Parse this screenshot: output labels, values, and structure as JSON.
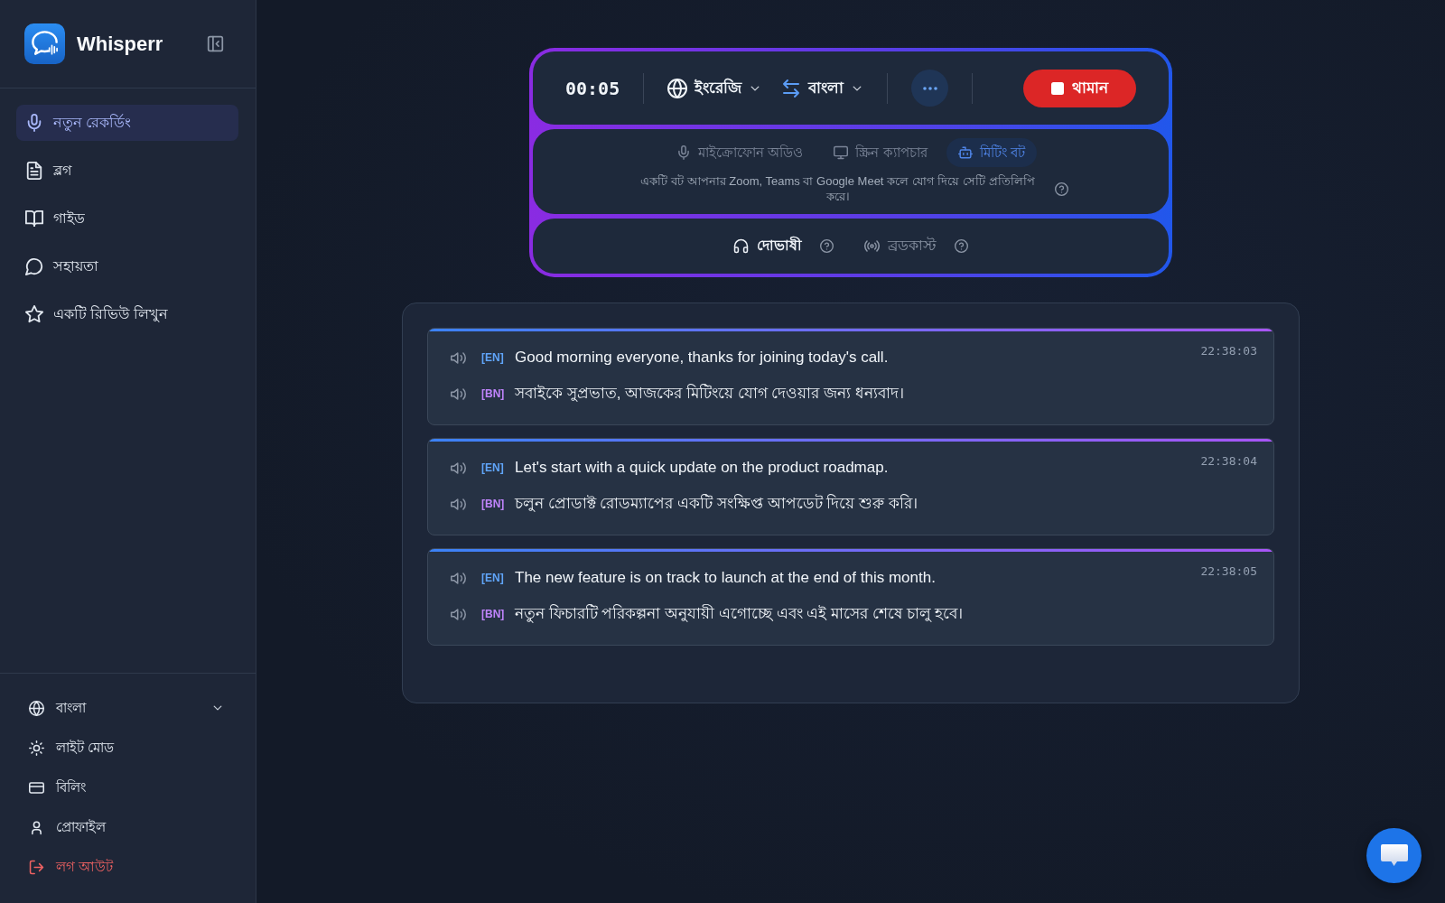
{
  "sidebar": {
    "app_name": "Whisperr",
    "nav": [
      {
        "label": "নতুন রেকর্ডিং",
        "selected": true
      },
      {
        "label": "ব্লগ",
        "selected": false
      },
      {
        "label": "গাইড",
        "selected": false
      },
      {
        "label": "সহায়তা",
        "selected": false
      },
      {
        "label": "একটি রিভিউ লিখুন",
        "selected": false
      }
    ],
    "footer": [
      {
        "label": "বাংলা",
        "kind": "select"
      },
      {
        "label": "লাইট মোড",
        "kind": "item"
      },
      {
        "label": "বিলিং",
        "kind": "item"
      },
      {
        "label": "প্রোফাইল",
        "kind": "item"
      },
      {
        "label": "লগ আউট",
        "kind": "danger"
      }
    ]
  },
  "recorder": {
    "timer": "00:05",
    "source_language": "ইংরেজি",
    "target_language": "বাংলা",
    "stop_label": "থামান",
    "sources": [
      {
        "label": "মাইক্রোফোন অডিও",
        "selected": false
      },
      {
        "label": "স্ক্রিন ক্যাপচার",
        "selected": false
      },
      {
        "label": "মিটিং বট",
        "selected": true
      }
    ],
    "source_description": "একটি বট আপনার Zoom, Teams বা Google Meet কলে যোগ দিয়ে সেটি প্রতিলিপি করে।",
    "modes": [
      {
        "label": "দোভাষী",
        "selected": true
      },
      {
        "label": "ব্রডকাস্ট",
        "selected": false
      }
    ]
  },
  "transcript": [
    {
      "time": "22:38:03",
      "lines": [
        {
          "kind": "source",
          "tag": "[EN]",
          "text": "Good morning everyone, thanks for joining today's call."
        },
        {
          "kind": "translation",
          "tag": "[BN]",
          "text": "সবাইকে সুপ্রভাত, আজকের মিটিংয়ে যোগ দেওয়ার জন্য ধন্যবাদ।"
        }
      ]
    },
    {
      "time": "22:38:04",
      "lines": [
        {
          "kind": "source",
          "tag": "[EN]",
          "text": "Let's start with a quick update on the product roadmap."
        },
        {
          "kind": "translation",
          "tag": "[BN]",
          "text": "চলুন প্রোডাক্ট রোডম্যাপের একটি সংক্ষিপ্ত আপডেট দিয়ে শুরু করি।"
        }
      ]
    },
    {
      "time": "22:38:05",
      "lines": [
        {
          "kind": "source",
          "tag": "[EN]",
          "text": "The new feature is on track to launch at the end of this month."
        },
        {
          "kind": "translation",
          "tag": "[BN]",
          "text": "নতুন ফিচারটি পরিকল্পনা অনুযায়ী এগোচ্ছে এবং এই মাসের শেষে চালু হবে।"
        }
      ]
    }
  ]
}
